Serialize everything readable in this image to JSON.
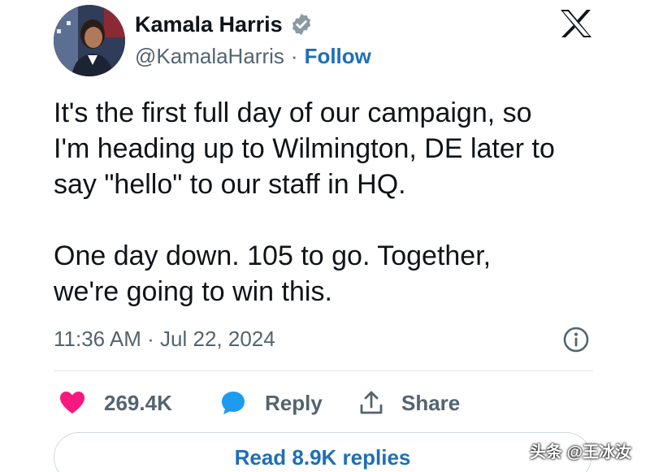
{
  "author": {
    "display_name": "Kamala Harris",
    "handle": "@KamalaHarris",
    "separator": "·",
    "follow_label": "Follow",
    "verified": true
  },
  "tweet": {
    "lines_p1": [
      "It's the first full day of our campaign, so",
      "I'm heading up to Wilmington, DE later to",
      "say \"hello\" to our staff in HQ."
    ],
    "lines_p2": [
      "One day down. 105 to go. Together,",
      "we're going to win this."
    ],
    "timestamp": "11:36 AM · Jul 22, 2024"
  },
  "actions": {
    "likes": "269.4K",
    "reply_label": "Reply",
    "share_label": "Share",
    "read_replies_label": "Read 8.9K replies"
  },
  "icons": {
    "brand": "x-logo-icon",
    "verified": "verified-badge-icon",
    "info": "info-icon",
    "like": "heart-icon",
    "reply": "reply-bubble-icon",
    "share": "share-icon"
  },
  "colors": {
    "accent": "#1d6fb8",
    "like": "#f91880",
    "reply": "#1d9bf0",
    "muted": "#536471"
  },
  "watermark": "头条 @王冰汝"
}
